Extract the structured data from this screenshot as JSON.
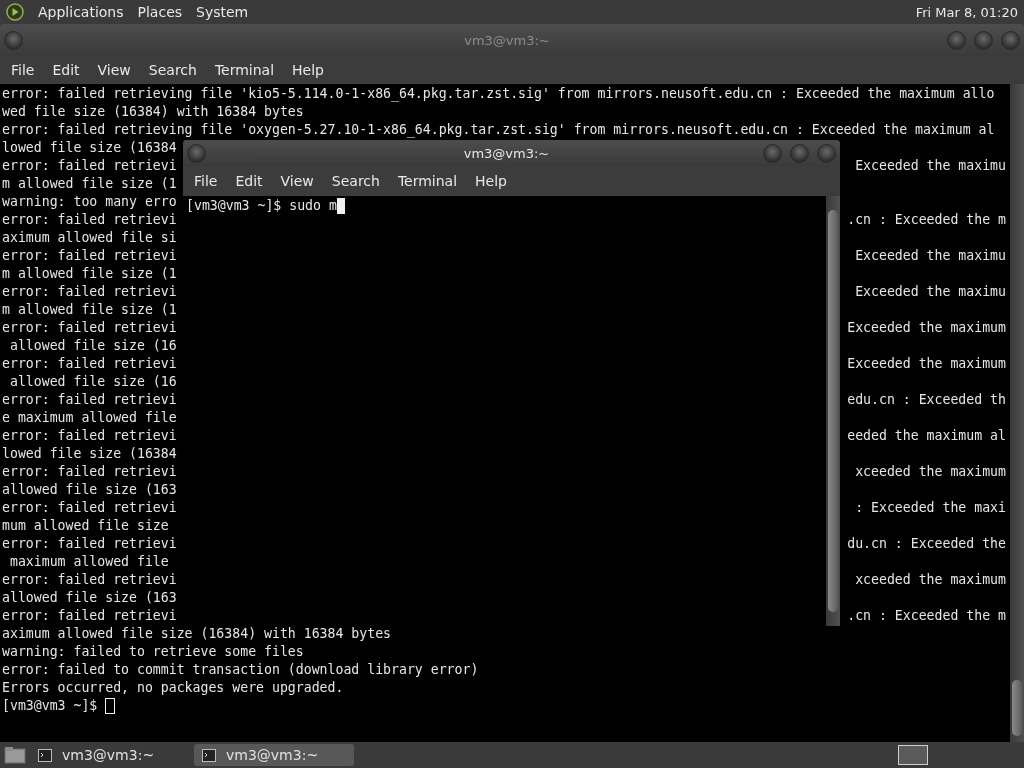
{
  "panel": {
    "menus": [
      "Applications",
      "Places",
      "System"
    ],
    "clock": "Fri Mar 8, 01:20"
  },
  "windows": [
    {
      "title": "vm3@vm3:~",
      "active": false,
      "menu": [
        "File",
        "Edit",
        "View",
        "Search",
        "Terminal",
        "Help"
      ],
      "lines": [
        {
          "left": "error: failed retrieving file 'kio5-5.114.0-1-x86_64.pkg.tar.zst.sig' from mirrors.neusoft.edu.cn : Exceeded the maximum allo"
        },
        {
          "left": "wed file size (16384) with 16384 bytes"
        },
        {
          "left": "error: failed retrieving file 'oxygen-5.27.10-1-x86_64.pkg.tar.zst.sig' from mirrors.neusoft.edu.cn : Exceeded the maximum al"
        },
        {
          "left": "lowed file size (16384"
        },
        {
          "left": "error: failed retrievi",
          "right": "Exceeded the maximu"
        },
        {
          "left": "m allowed file size (1"
        },
        {
          "left": "warning: too many erro"
        },
        {
          "left": "error: failed retrievi",
          "right": ".cn : Exceeded the m"
        },
        {
          "left": "aximum allowed file si"
        },
        {
          "left": "error: failed retrievi",
          "right": "Exceeded the maximu"
        },
        {
          "left": "m allowed file size (1"
        },
        {
          "left": "error: failed retrievi",
          "right": "Exceeded the maximu"
        },
        {
          "left": "m allowed file size (1"
        },
        {
          "left": "error: failed retrievi",
          "right": "Exceeded the maximum"
        },
        {
          "left": " allowed file size (16"
        },
        {
          "left": "error: failed retrievi",
          "right": "Exceeded the maximum"
        },
        {
          "left": " allowed file size (16"
        },
        {
          "left": "error: failed retrievi",
          "right": "edu.cn : Exceeded th"
        },
        {
          "left": "e maximum allowed file"
        },
        {
          "left": "error: failed retrievi",
          "right": "eeded the maximum al"
        },
        {
          "left": "lowed file size (16384"
        },
        {
          "left": "error: failed retrievi",
          "right": "xceeded the maximum"
        },
        {
          "left": "allowed file size (163"
        },
        {
          "left": "error: failed retrievi",
          "right": ": Exceeded the maxi"
        },
        {
          "left": "mum allowed file size"
        },
        {
          "left": "error: failed retrievi",
          "right": "du.cn : Exceeded the"
        },
        {
          "left": " maximum allowed file"
        },
        {
          "left": "error: failed retrievi",
          "right": "xceeded the maximum"
        },
        {
          "left": "allowed file size (163"
        },
        {
          "left": "error: failed retrievi",
          "right": ".cn : Exceeded the m"
        },
        {
          "left": "aximum allowed file size (16384) with 16384 bytes"
        },
        {
          "left": "warning: failed to retrieve some files"
        },
        {
          "left": "error: failed to commit transaction (download library error)"
        },
        {
          "left": "Errors occurred, no packages were upgraded."
        }
      ],
      "prompt": "[vm3@vm3 ~]$"
    },
    {
      "title": "vm3@vm3:~",
      "active": true,
      "menu": [
        "File",
        "Edit",
        "View",
        "Search",
        "Terminal",
        "Help"
      ],
      "prompt": "[vm3@vm3 ~]$ sudo m"
    }
  ],
  "taskbar": [
    {
      "label": "vm3@vm3:~",
      "selected": false
    },
    {
      "label": "vm3@vm3:~",
      "selected": true
    }
  ]
}
